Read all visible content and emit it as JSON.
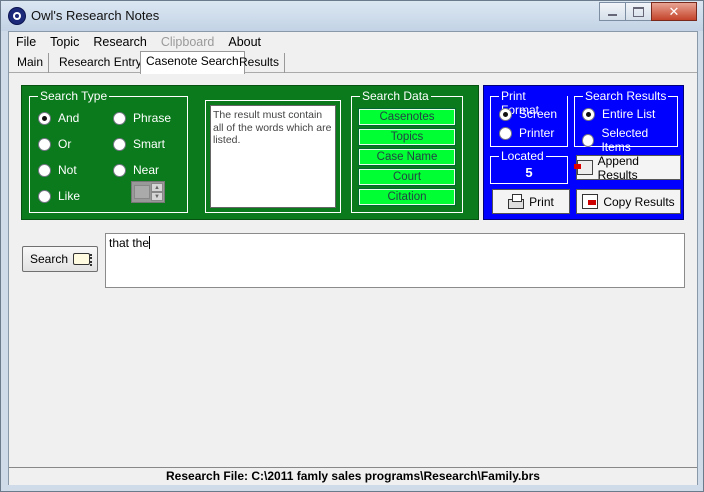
{
  "window": {
    "title": "Owl's Research Notes",
    "close_glyph": "✕"
  },
  "menu": [
    {
      "label": "File",
      "disabled": false
    },
    {
      "label": "Topic",
      "disabled": false
    },
    {
      "label": "Research",
      "disabled": false
    },
    {
      "label": "Clipboard",
      "disabled": true
    },
    {
      "label": "About",
      "disabled": false
    }
  ],
  "tabs": [
    {
      "label": "Main",
      "active": false
    },
    {
      "label": "Research Entry",
      "active": false
    },
    {
      "label": "Casenote Search",
      "active": true
    },
    {
      "label": "Results",
      "active": false
    }
  ],
  "search_type": {
    "title": "Search Type",
    "options": [
      {
        "label": "And",
        "selected": true
      },
      {
        "label": "Or",
        "selected": false
      },
      {
        "label": "Not",
        "selected": false
      },
      {
        "label": "Like",
        "selected": false
      },
      {
        "label": "Phrase",
        "selected": false
      },
      {
        "label": "Smart",
        "selected": false
      },
      {
        "label": "Near",
        "selected": false
      }
    ]
  },
  "description": "The result must contain all of the words which are listed.",
  "search_data": {
    "title": "Search Data",
    "buttons": [
      "Casenotes",
      "Topics",
      "Case Name",
      "Court",
      "Citation"
    ]
  },
  "print_format": {
    "title": "Print Format",
    "options": [
      {
        "label": "Screen",
        "selected": true
      },
      {
        "label": "Printer",
        "selected": false
      }
    ]
  },
  "search_results": {
    "title": "Search Results",
    "options": [
      {
        "label": "Entire List",
        "selected": true
      },
      {
        "label": "Selected Items",
        "selected": false
      }
    ]
  },
  "located": {
    "title": "Located",
    "value": "5"
  },
  "buttons": {
    "append": "Append Results",
    "print": "Print",
    "copy": "Copy Results",
    "search": "Search"
  },
  "query": "that the",
  "status": "Research File: C:\\2011 famly sales programs\\Research\\Family.brs"
}
